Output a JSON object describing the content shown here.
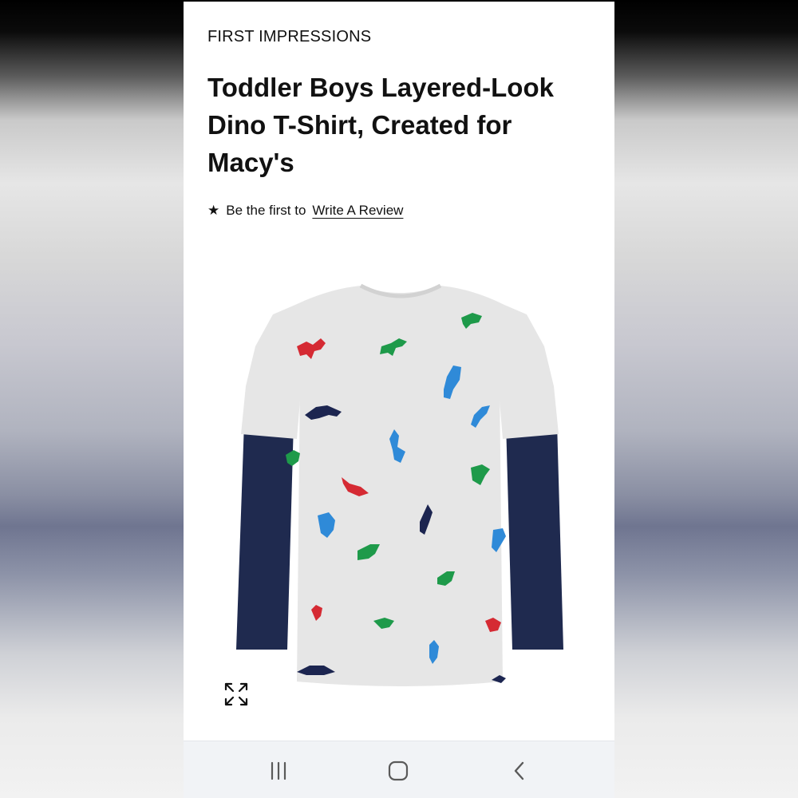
{
  "product": {
    "brand": "FIRST IMPRESSIONS",
    "title": "Toddler Boys Layered-Look Dino T-Shirt, Created for Macy's",
    "rating_prefix": "Be the first to",
    "review_link": "Write A Review"
  },
  "icons": {
    "rating": "star-icon",
    "expand": "expand-icon",
    "recents": "recent-apps-icon",
    "home": "home-icon",
    "back": "back-icon"
  },
  "colors": {
    "text": "#111111",
    "shirt_body": "#e6e6e6",
    "sleeve": "#1f2a4f",
    "dino_red": "#d52a33",
    "dino_green": "#1e9a4a",
    "dino_blue": "#2f8ad8",
    "dino_navy": "#1c2550",
    "nav_bar_bg": "#f1f3f6"
  }
}
